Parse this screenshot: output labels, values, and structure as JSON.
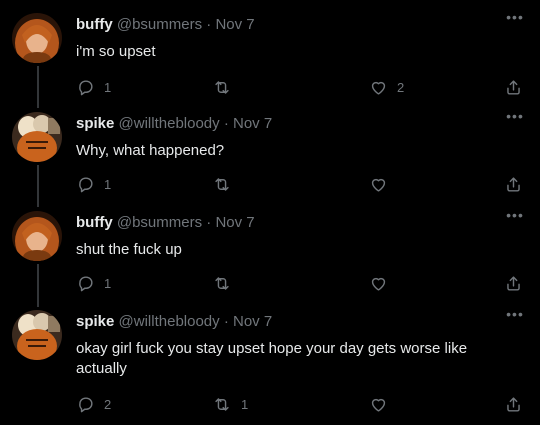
{
  "tweets": [
    {
      "name": "buffy",
      "handle": "@bsummers",
      "dot": "·",
      "date": "Nov 7",
      "text": "i'm so upset",
      "replies": "1",
      "retweets": "",
      "likes": "2",
      "avatar_icon": "buffy-avatar"
    },
    {
      "name": "spike",
      "handle": "@willthebloody",
      "dot": "·",
      "date": "Nov 7",
      "text": "Why, what happened?",
      "replies": "1",
      "retweets": "",
      "likes": "",
      "avatar_icon": "spike-avatar"
    },
    {
      "name": "buffy",
      "handle": "@bsummers",
      "dot": "·",
      "date": "Nov 7",
      "text": "shut the fuck up",
      "replies": "1",
      "retweets": "",
      "likes": "",
      "avatar_icon": "buffy-avatar"
    },
    {
      "name": "spike",
      "handle": "@willthebloody",
      "dot": "·",
      "date": "Nov 7",
      "text": "okay girl fuck you stay upset hope your day gets worse like actually",
      "replies": "2",
      "retweets": "1",
      "likes": "",
      "avatar_icon": "spike-avatar"
    }
  ],
  "icons": {
    "more": "•••",
    "reply": "reply-icon",
    "retweet": "retweet-icon",
    "like": "heart-icon",
    "share": "share-icon"
  },
  "colors": {
    "background": "#000000",
    "text": "#e7e9ea",
    "muted": "#71767b",
    "thread_line": "#333639"
  }
}
